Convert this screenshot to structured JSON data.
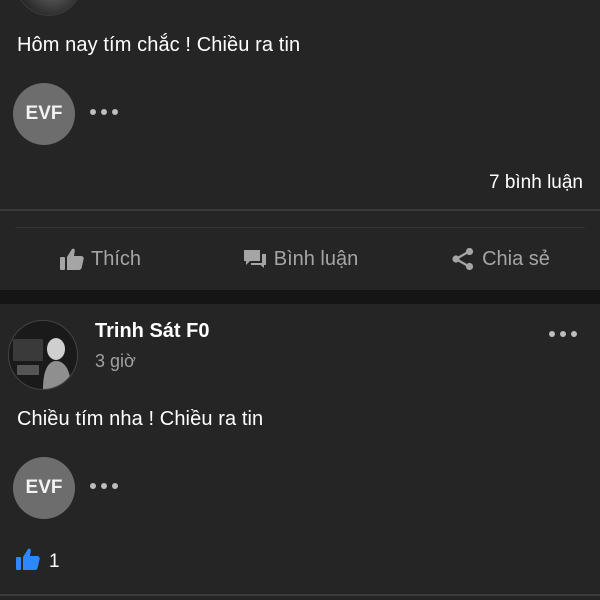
{
  "post1": {
    "text": "Hôm nay tím chắc ! Chiều ra tin",
    "commenter_initials": "EVF",
    "comments_count": "7 bình luận"
  },
  "actions": {
    "like": "Thích",
    "comment": "Bình luận",
    "share": "Chia sẻ"
  },
  "post2": {
    "author": "Trinh Sát F0",
    "time": "3 giờ",
    "text": "Chiều tím nha ! Chiều ra tin",
    "commenter_initials": "EVF",
    "like_count": "1"
  },
  "colors": {
    "background": "#252525",
    "like_blue": "#2d88ff",
    "muted_text": "#a5a5a5"
  }
}
